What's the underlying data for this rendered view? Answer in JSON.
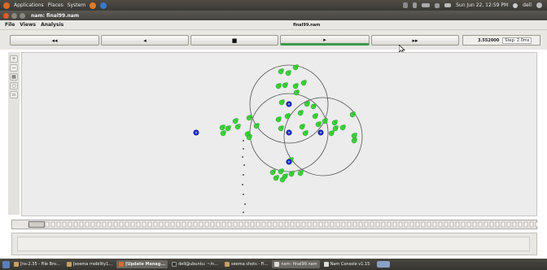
{
  "top_panel": {
    "menus": [
      "Applications",
      "Places",
      "System"
    ],
    "datetime": "Sun Jun 22, 12:59 PM",
    "user": "dell"
  },
  "window": {
    "title": "nam: final99.nam"
  },
  "menubar": {
    "items": [
      "File",
      "Views",
      "Analysis"
    ],
    "filename": "final99.nam"
  },
  "toolbar": {
    "rewind_label": "◂◂",
    "back_label": "◂",
    "stop_label": "■",
    "play_label": "▸",
    "ffwd_label": "▸▸",
    "time": "3.552000",
    "step": "Step: 2.0ms"
  },
  "sidebar": {
    "tools": [
      "zoom-in-icon",
      "zoom-out-icon",
      "grid-icon",
      "select-icon",
      "edit-icon"
    ]
  },
  "canvas": {
    "colors": {
      "node_green": "#3dd23d",
      "node_blue": "#2233cc",
      "range_circle": "#555555",
      "background": "#ececec"
    }
  },
  "taskbar": {
    "items": [
      {
        "label": "[ns-2.35 - File Bro...",
        "active": false
      },
      {
        "label": "[seema mobility1...",
        "active": false
      },
      {
        "label": "[Update Manag...",
        "active": true
      },
      {
        "label": "dell@ubuntu: ~/n...",
        "active": false
      },
      {
        "label": "seema shots - Fi...",
        "active": false
      },
      {
        "label": "nam: final99.nam",
        "active": true
      },
      {
        "label": "Nam Console v1.15",
        "active": false
      }
    ]
  }
}
